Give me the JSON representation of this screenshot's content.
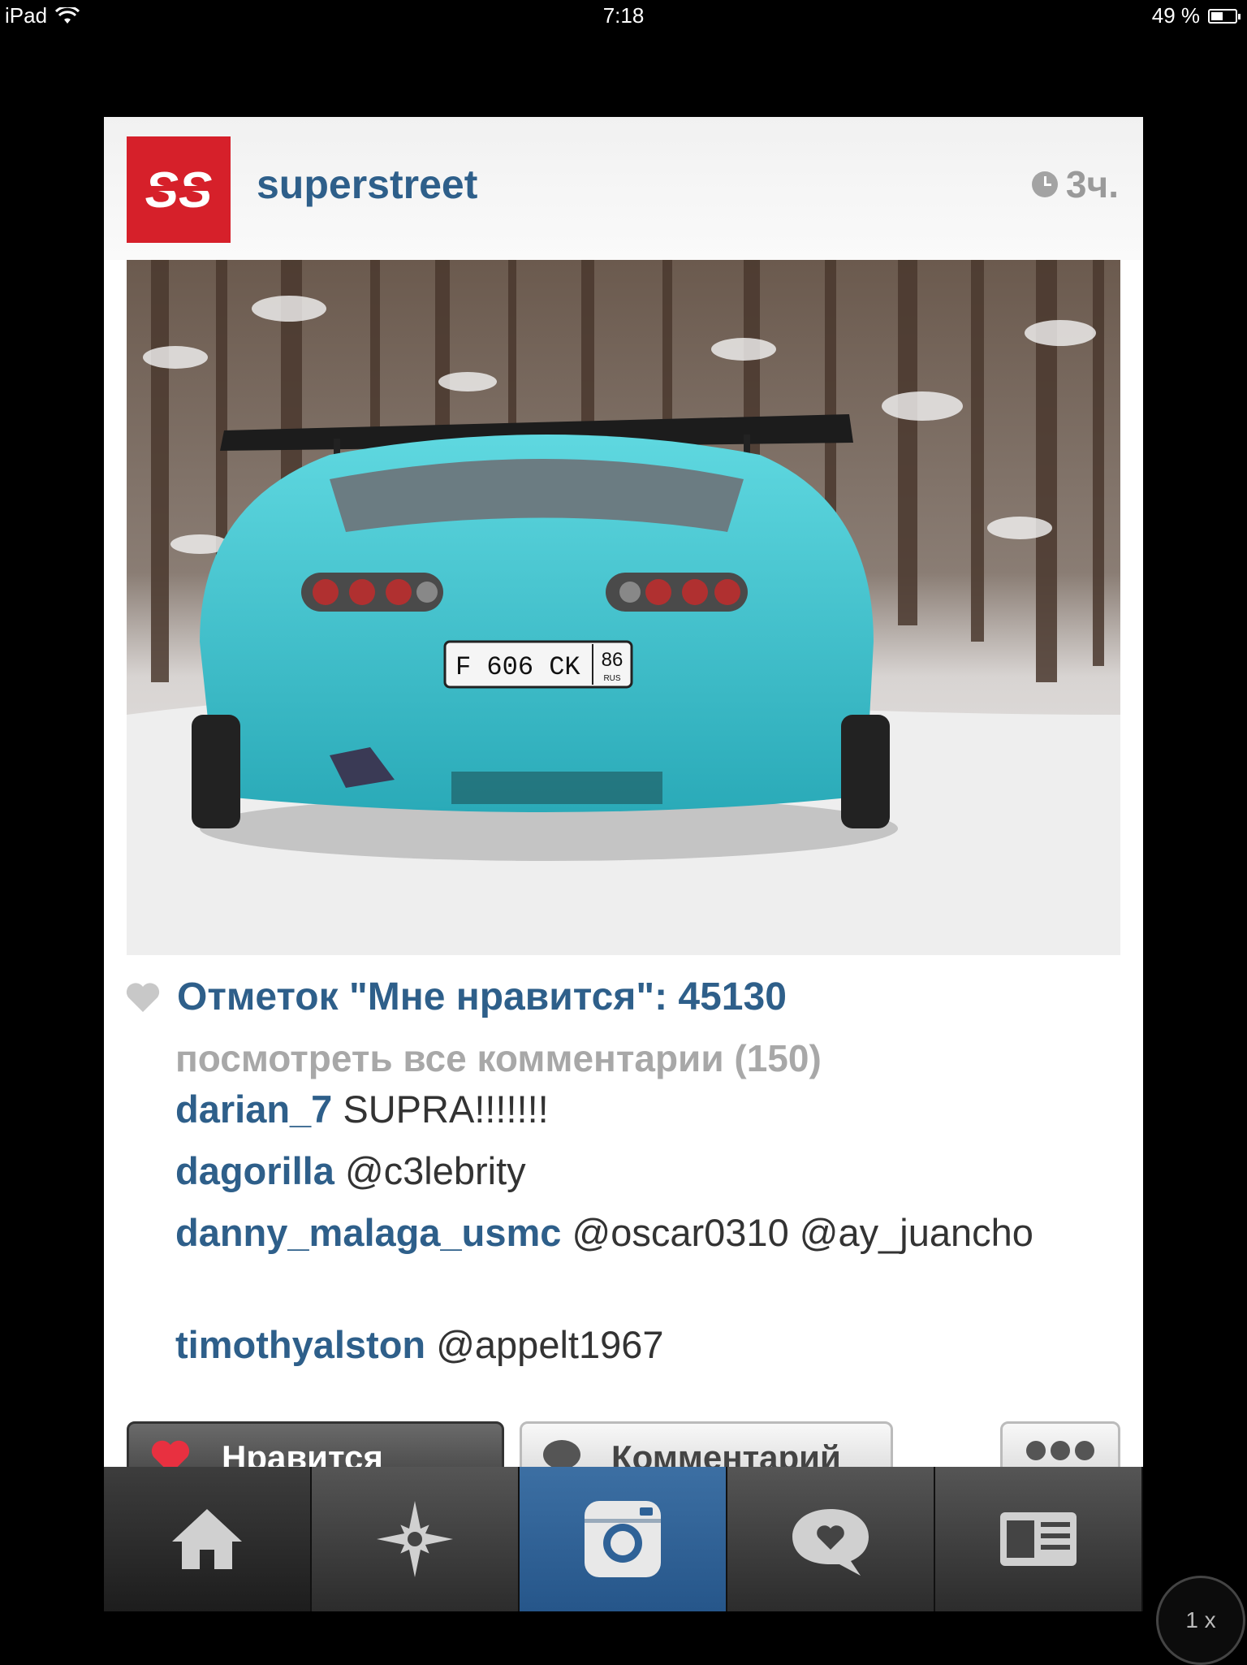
{
  "status_bar": {
    "device": "iPad",
    "time": "7:18",
    "battery": "49 %",
    "battery_level": 0.49
  },
  "post": {
    "username": "superstreet",
    "time_ago": "3ч.",
    "photo_icon": "car-photo",
    "plate": {
      "number": "F 606 CK",
      "region": "86",
      "country": "RUS"
    },
    "likes_text": "Отметок \"Мне нравится\": 45130",
    "view_all": "посмотреть все комментарии (150)",
    "comments": [
      {
        "user": "darian_7",
        "text": "SUPRA!!!!!!!"
      },
      {
        "user": "dagorilla",
        "text": "@c3lebrity"
      },
      {
        "user": "danny_malaga_usmc",
        "text": "@oscar0310 @ay_juancho"
      },
      {
        "user": "timothyalston",
        "text": "@appelt1967"
      }
    ]
  },
  "actions": {
    "like": "Нравится",
    "comment": "Комментарий"
  },
  "tabs": [
    "home-icon",
    "explore-icon",
    "camera-icon",
    "news-icon",
    "profile-icon"
  ],
  "zoom": "1 x",
  "colors": {
    "link": "#2e5f8a",
    "active_tab": "#2f6297",
    "logo_red": "#d6202a"
  }
}
